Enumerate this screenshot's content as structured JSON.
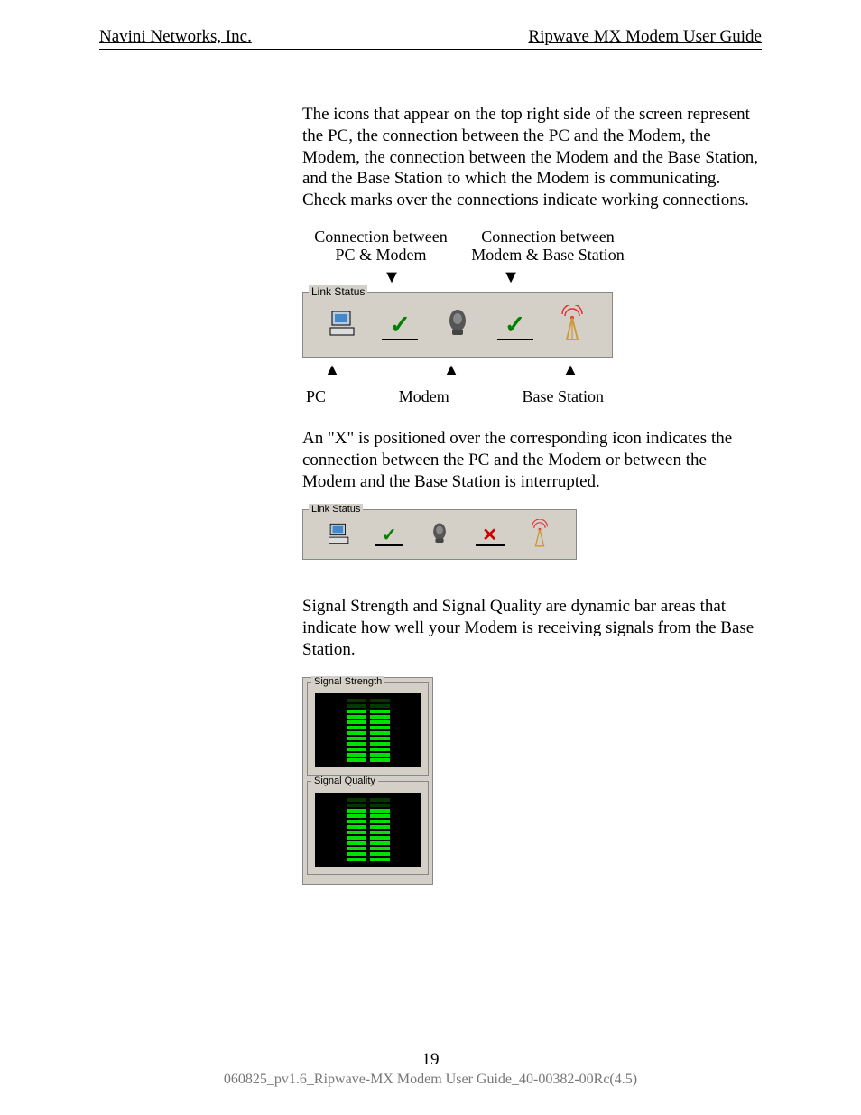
{
  "header": {
    "left": "Navini Networks, Inc.",
    "right": "Ripwave MX Modem User Guide"
  },
  "p1": "The icons that appear on the top right side of the screen represent the PC, the connection between the PC and the Modem, the Modem, the connection between the Modem and the Base Station, and the Base Station to which the Modem is communicating. Check marks over the connections indicate working connections.",
  "diagram1": {
    "top_ann_left_line1": "Connection between",
    "top_ann_left_line2": "PC & Modem",
    "top_ann_right_line1": "Connection between",
    "top_ann_right_line2": "Modem & Base Station",
    "panel_legend": "Link Status",
    "bottom_pc": "PC",
    "bottom_modem": "Modem",
    "bottom_bs": "Base Station"
  },
  "p2": "An \"X\" is positioned over the corresponding icon indicates the connection between the PC and the Modem or between the Modem and the Base Station is interrupted.",
  "diagram2": {
    "panel_legend": "Link Status"
  },
  "p3": "Signal Strength and Signal Quality are dynamic bar areas that indicate how well your Modem is receiving signals from the Base Station.",
  "signal": {
    "strength_label": "Signal Strength",
    "quality_label": "Signal Quality"
  },
  "chart_data": [
    {
      "type": "bar",
      "title": "Signal Strength",
      "series": [
        {
          "name": "left",
          "segments_total": 12,
          "segments_on": 10
        },
        {
          "name": "right",
          "segments_total": 12,
          "segments_on": 10
        }
      ]
    },
    {
      "type": "bar",
      "title": "Signal Quality",
      "series": [
        {
          "name": "left",
          "segments_total": 12,
          "segments_on": 10
        },
        {
          "name": "right",
          "segments_total": 12,
          "segments_on": 10
        }
      ]
    }
  ],
  "footer": {
    "page_number": "19",
    "doc_ref": "060825_pv1.6_Ripwave-MX Modem User Guide_40-00382-00Rc(4.5)"
  }
}
